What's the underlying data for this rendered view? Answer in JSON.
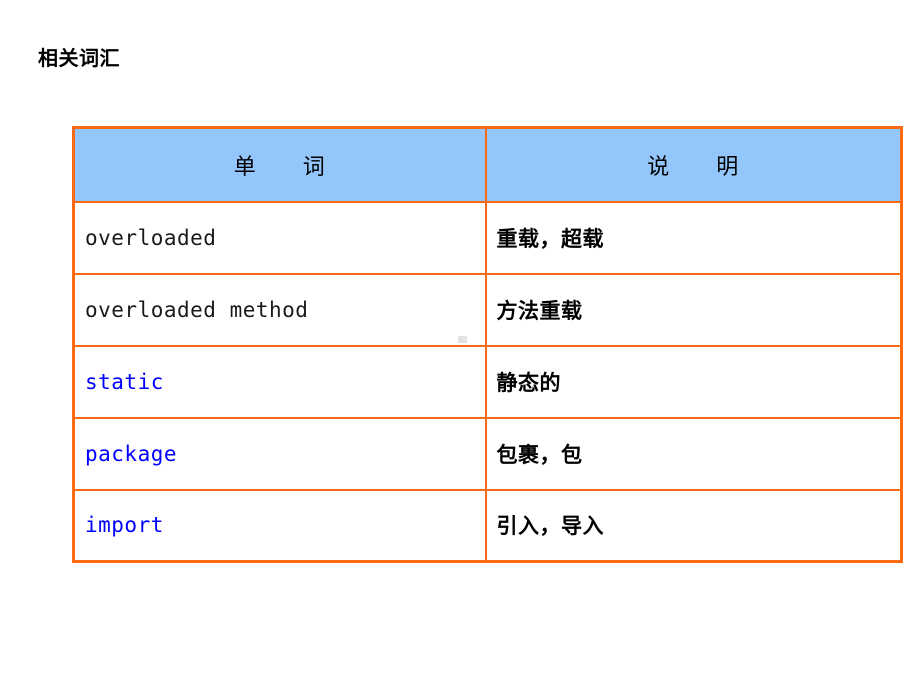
{
  "slide": {
    "title": "相关词汇",
    "background_color": "#ffffff"
  },
  "colors": {
    "table_border": "#f96a13",
    "header_fill": "#93c6fb",
    "accent_text": "#0000ff",
    "body_text": "#000000"
  },
  "table": {
    "headers": {
      "word": "单　　词",
      "description": "说　　明"
    },
    "rows": [
      {
        "word": "overloaded",
        "description": "重载，超载",
        "word_color": "#1a1a1a"
      },
      {
        "word": "overloaded method",
        "description": "方法重载",
        "word_color": "#1a1a1a"
      },
      {
        "word": "static",
        "description": "静态的",
        "word_color": "#0000ff"
      },
      {
        "word": "package",
        "description": "包裹，包",
        "word_color": "#0000ff"
      },
      {
        "word": "import",
        "description": "引入，导入",
        "word_color": "#0000ff"
      }
    ]
  }
}
